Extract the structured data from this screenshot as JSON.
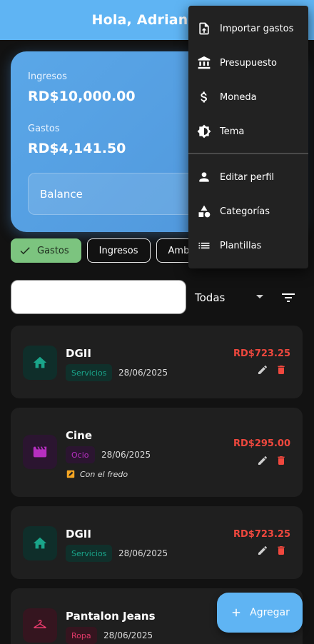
{
  "appbar": {
    "title": "Hola, Adrian"
  },
  "summary": {
    "income_label": "Ingresos",
    "income_value": "RD$10,000.00",
    "expense_label": "Gastos",
    "expense_value": "RD$4,141.50",
    "balance_label": "Balance"
  },
  "chips": [
    {
      "label": "Gastos",
      "selected": true
    },
    {
      "label": "Ingresos",
      "selected": false
    },
    {
      "label": "Amb",
      "selected": false
    }
  ],
  "search": {
    "value": "",
    "placeholder": ""
  },
  "filter": {
    "selected": "Todas"
  },
  "transactions": [
    {
      "title": "DGII",
      "category": "Servicios",
      "date": "28/06/2025",
      "amount": "RD$723.25",
      "icon": "home-icon",
      "note": ""
    },
    {
      "title": "Cine",
      "category": "Ocio",
      "date": "28/06/2025",
      "amount": "RD$295.00",
      "icon": "movie-icon",
      "note": "Con el fredo"
    },
    {
      "title": "DGII",
      "category": "Servicios",
      "date": "28/06/2025",
      "amount": "RD$723.25",
      "icon": "home-icon",
      "note": ""
    },
    {
      "title": "Pantalon Jeans",
      "category": "Ropa",
      "date": "28/06/2025",
      "amount": "",
      "icon": "hanger-icon",
      "note": ""
    }
  ],
  "fab": {
    "label": "Agregar"
  },
  "menu": {
    "items": [
      {
        "label": "Importar gastos",
        "icon": "file-upload-icon"
      },
      {
        "label": "Presupuesto",
        "icon": "bank-icon"
      },
      {
        "label": "Moneda",
        "icon": "dollar-icon"
      },
      {
        "label": "Tema",
        "icon": "brightness-icon"
      },
      {
        "label": "Editar perfil",
        "icon": "person-icon"
      },
      {
        "label": "Categorías",
        "icon": "category-icon"
      },
      {
        "label": "Plantillas",
        "icon": "list-icon"
      }
    ]
  },
  "colors": {
    "primary": "#5fb4f3",
    "selected_chip": "#7cc47f",
    "expense_red": "#f0483e",
    "services_teal": "#1aa58a",
    "ocio_purple": "#b62fc0",
    "ropa_pink": "#e23a6a"
  }
}
